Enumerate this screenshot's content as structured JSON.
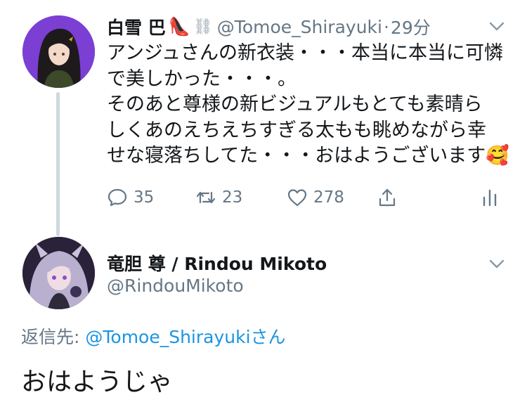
{
  "tweet1": {
    "display_name": "白雪 巴",
    "name_emojis": [
      "👠",
      "⛓"
    ],
    "handle": "@Tomoe_Shirayuki",
    "separator": "·",
    "time": "29分",
    "body_lines": [
      "アンジュさんの新衣装・・・本当に本当に可憐",
      "で美しかった・・・。",
      "そのあと尊様の新ビジュアルもとても素晴ら",
      "しくあのえちえちすぎる太もも眺めながら幸",
      "せな寝落ちしてた・・・おはようございます🥰"
    ],
    "actions": {
      "reply_count": "35",
      "retweet_count": "23",
      "like_count": "278"
    }
  },
  "tweet2": {
    "display_name": "竜胆 尊 / Rindou Mikoto",
    "handle": "@RindouMikoto",
    "reply_to_prefix": "返信先: ",
    "reply_to_mention": "@Tomoe_Shirayuki",
    "reply_to_suffix": "さん",
    "text": "おはようじゃ"
  },
  "icons": [
    "chevron-down-icon",
    "reply-icon",
    "retweet-icon",
    "like-icon",
    "share-icon",
    "analytics-icon"
  ],
  "colors": {
    "text_primary": "#14171a",
    "text_secondary": "#657786",
    "link": "#1b95e0",
    "thread_line": "#cfd9de",
    "avatar1_bg": "#7b3fd4"
  }
}
